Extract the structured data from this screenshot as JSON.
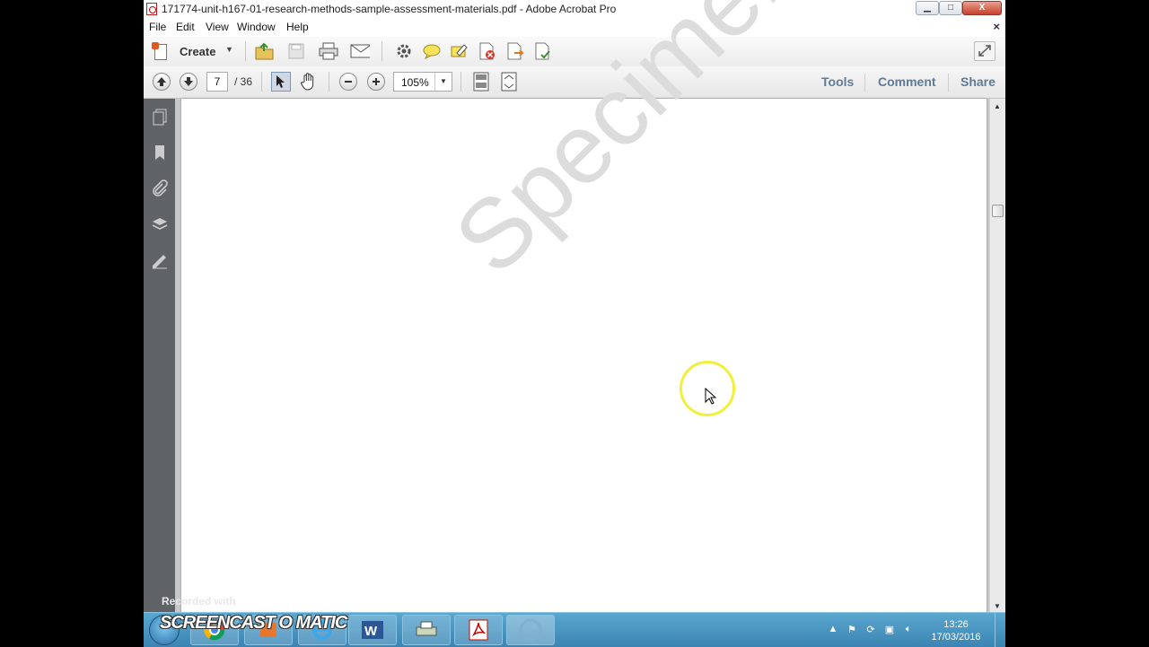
{
  "window": {
    "title": "171774-unit-h167-01-research-methods-sample-assessment-materials.pdf - Adobe Acrobat Pro",
    "min_label": "▁",
    "max_label": "□",
    "close_label": "X"
  },
  "menu": {
    "items": [
      "File",
      "Edit",
      "View",
      "Window",
      "Help"
    ],
    "doc_close": "×"
  },
  "toolbar": {
    "create_label": "Create",
    "icons": [
      "open-icon",
      "save-icon",
      "print-icon",
      "email-icon",
      "settings-icon",
      "comment-icon",
      "highlight-icon",
      "delete-page-icon",
      "export-icon",
      "sign-icon"
    ]
  },
  "nav": {
    "page_current": "7",
    "page_total": "/ 36",
    "zoom": "105%"
  },
  "panes": {
    "tools": "Tools",
    "comment": "Comment",
    "share": "Share"
  },
  "document": {
    "watermark": "Specimen"
  },
  "recording": {
    "recorded_with": "Recorded with",
    "brand": "SCREENCAST O MATIC"
  },
  "taskbar": {
    "apps": [
      "chrome",
      "paint",
      "ie",
      "word",
      "printer",
      "acrobat",
      "acrobat-running"
    ],
    "time": "13:26",
    "date": "17/03/2016"
  }
}
